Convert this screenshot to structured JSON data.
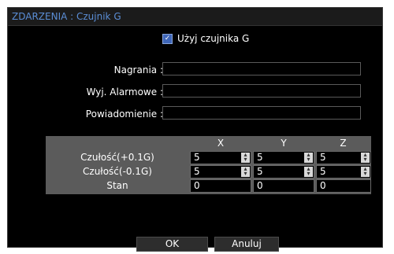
{
  "window": {
    "title": "ZDARZENIA : Czujnik G"
  },
  "sensor": {
    "checkbox_checked": true,
    "checkbox_label": "Użyj czujnika G"
  },
  "fields": [
    {
      "label": "Nagrania :",
      "value": ""
    },
    {
      "label": "Wyj. Alarmowe :",
      "value": ""
    },
    {
      "label": "Powiadomienie :",
      "value": ""
    }
  ],
  "grid": {
    "columns": [
      "X",
      "Y",
      "Z"
    ],
    "rows": [
      {
        "label": "Czułość(+0.1G)",
        "values": [
          "5",
          "5",
          "5"
        ]
      },
      {
        "label": "Czułość(-0.1G)",
        "values": [
          "5",
          "5",
          "5"
        ]
      },
      {
        "label": "Stan",
        "values": [
          "0",
          "0",
          "0"
        ]
      }
    ]
  },
  "buttons": {
    "ok": "OK",
    "cancel": "Anuluj"
  },
  "colors": {
    "title": "#5b8ed6",
    "checkbox": "#3f66b8",
    "grid_bg": "#5b5b5b"
  }
}
